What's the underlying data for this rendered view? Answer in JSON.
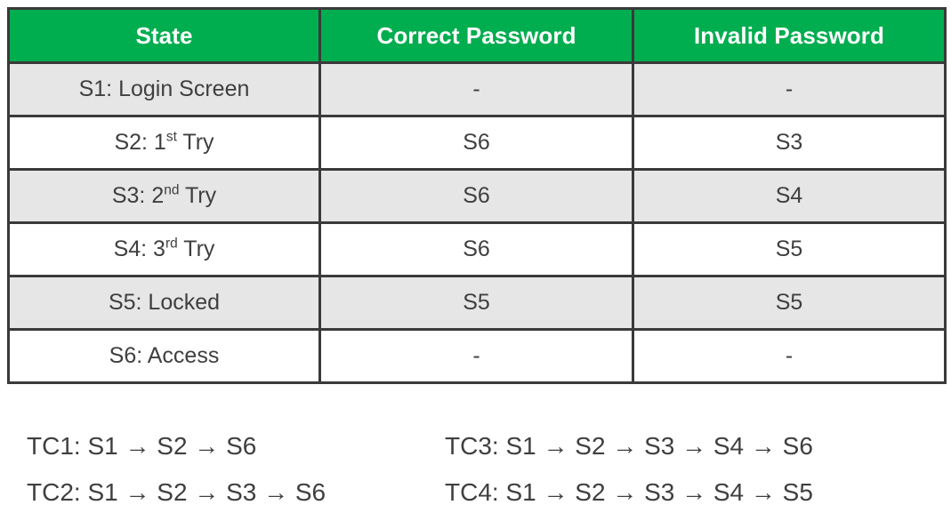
{
  "table": {
    "headers": [
      "State",
      "Correct Password",
      "Invalid Password"
    ],
    "rows": [
      {
        "state_prefix": "S1: Login Screen",
        "state_ordinal": "",
        "state_suffix": "",
        "correct": "-",
        "invalid": "-"
      },
      {
        "state_prefix": "S2: 1",
        "state_ordinal": "st",
        "state_suffix": " Try",
        "correct": "S6",
        "invalid": "S3"
      },
      {
        "state_prefix": "S3: 2",
        "state_ordinal": "nd",
        "state_suffix": " Try",
        "correct": "S6",
        "invalid": "S4"
      },
      {
        "state_prefix": "S4: 3",
        "state_ordinal": "rd",
        "state_suffix": " Try",
        "correct": "S6",
        "invalid": "S5"
      },
      {
        "state_prefix": "S5: Locked",
        "state_ordinal": "",
        "state_suffix": "",
        "correct": "S5",
        "invalid": "S5"
      },
      {
        "state_prefix": "S6: Access",
        "state_ordinal": "",
        "state_suffix": "",
        "correct": "-",
        "invalid": "-"
      }
    ]
  },
  "test_cases": {
    "arrow": "→",
    "items": [
      {
        "id": "TC1",
        "label": "TC1:",
        "path": [
          "S1",
          "S2",
          "S6"
        ],
        "text": "TC1: S1 → S2 → S6"
      },
      {
        "id": "TC2",
        "label": "TC2:",
        "path": [
          "S1",
          "S2",
          "S3",
          "S6"
        ],
        "text": "TC2: S1 → S2 → S3 → S6"
      },
      {
        "id": "TC3",
        "label": "TC3:",
        "path": [
          "S1",
          "S2",
          "S3",
          "S4",
          "S6"
        ],
        "text": "TC3: S1 → S2 → S3 → S4 → S6"
      },
      {
        "id": "TC4",
        "label": "TC4:",
        "path": [
          "S1",
          "S2",
          "S3",
          "S4",
          "S5"
        ],
        "text": "TC4: S1 → S2 → S3 → S4 → S5"
      }
    ]
  },
  "colors": {
    "header_green": "#00AD4F",
    "header_text": "#FFFFFF",
    "row_shaded": "#E7E6E6",
    "row_plain": "#FFFFFF",
    "border": "#3A3A3A",
    "body_text": "#3F3F3F"
  }
}
